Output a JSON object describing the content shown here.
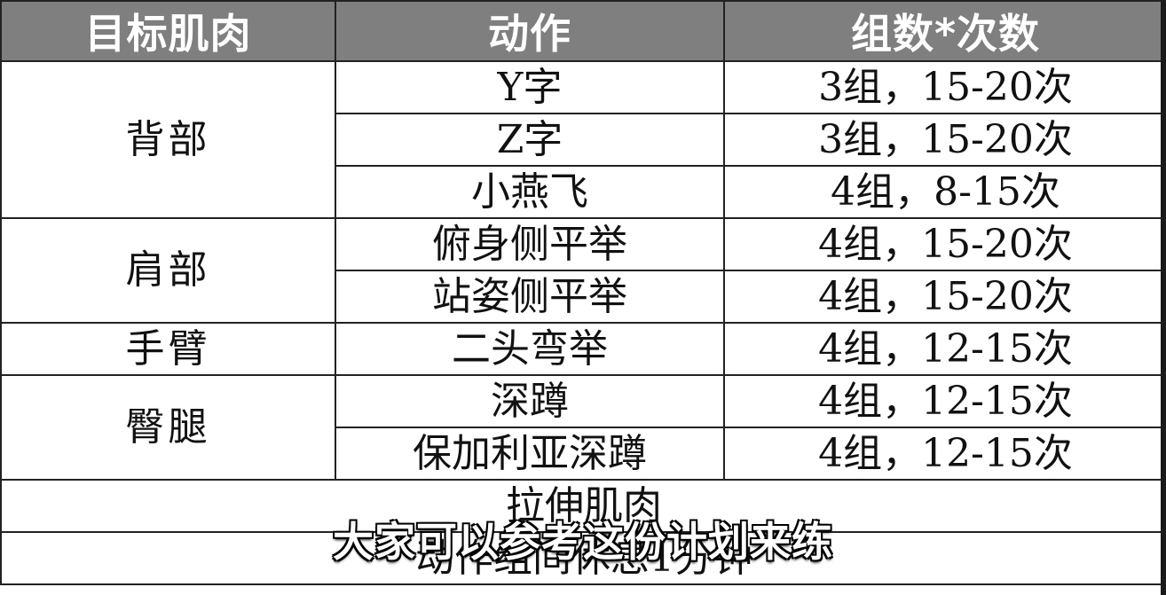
{
  "table": {
    "headers": [
      "目标肌肉",
      "动作",
      "组数*次数"
    ],
    "groups": [
      {
        "muscle": "背部",
        "rows": [
          {
            "exercise": "Y字",
            "sets": "3组，15-20次"
          },
          {
            "exercise": "Z字",
            "sets": "3组，15-20次"
          },
          {
            "exercise": "小燕飞",
            "sets": "4组，8-15次"
          }
        ]
      },
      {
        "muscle": "肩部",
        "rows": [
          {
            "exercise": "俯身侧平举",
            "sets": "4组，15-20次"
          },
          {
            "exercise": "站姿侧平举",
            "sets": "4组，15-20次"
          }
        ]
      },
      {
        "muscle": "手臂",
        "rows": [
          {
            "exercise": "二头弯举",
            "sets": "4组，12-15次"
          }
        ]
      },
      {
        "muscle": "臀腿",
        "rows": [
          {
            "exercise": "深蹲",
            "sets": "4组，12-15次"
          },
          {
            "exercise": "保加利亚深蹲",
            "sets": "4组，12-15次"
          }
        ]
      }
    ],
    "footer_rows": [
      "拉伸肌肉",
      "动作组间休息1分钟"
    ]
  },
  "subtitle": "大家可以参考这份计划来练"
}
